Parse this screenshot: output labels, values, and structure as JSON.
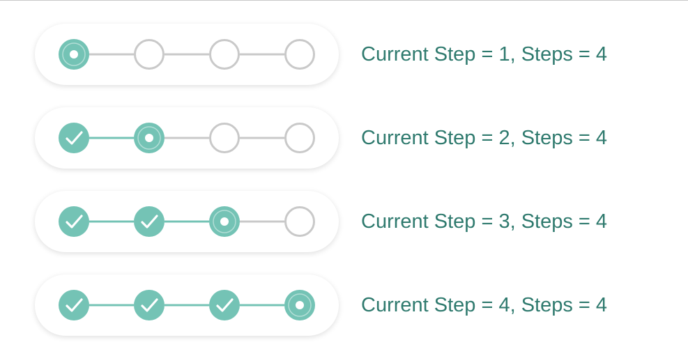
{
  "colors": {
    "active": "#74c3b5",
    "active_dark": "#56a99a",
    "inactive": "#c9c9c9",
    "text": "#2f7a6e"
  },
  "steppers": [
    {
      "current_step": 1,
      "steps": 4,
      "caption": "Current Step = 1, Steps = 4"
    },
    {
      "current_step": 2,
      "steps": 4,
      "caption": "Current Step = 2, Steps = 4"
    },
    {
      "current_step": 3,
      "steps": 4,
      "caption": "Current Step = 3, Steps = 4"
    },
    {
      "current_step": 4,
      "steps": 4,
      "caption": "Current Step = 4, Steps = 4"
    }
  ]
}
